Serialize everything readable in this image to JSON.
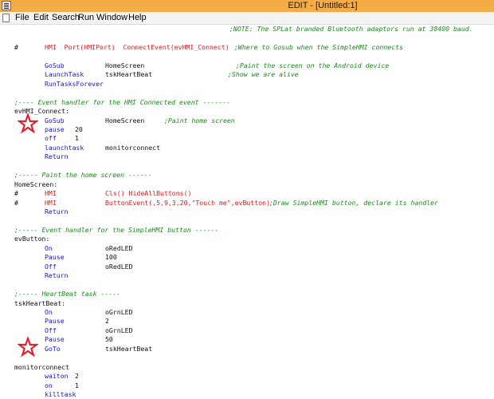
{
  "window": {
    "title": "EDIT - [Untitled:1]"
  },
  "menu": [
    "File",
    "Edit",
    "Search",
    "Run",
    "Window",
    "Help"
  ],
  "code": [
    {
      "t": [
        {
          "c": "cm",
          "s": ";NOTE: The SPLat branded Bluetooth adaptors run at 38400 baud."
        }
      ]
    },
    {
      "t": []
    },
    {
      "t": [
        {
          "c": "txt",
          "s": "#"
        },
        {
          "c": "red",
          "s": "HMI  Port(HMIPort)  ConnectEvent(evHMI_Connect)"
        },
        {
          "c": "cm",
          "s": ";Where to Gosub when the SimpleHMI connects"
        }
      ]
    },
    {
      "t": []
    },
    {
      "t": [
        {
          "c": "kw",
          "s": "GoSub"
        },
        {
          "c": "txt",
          "s": "HomeScreen"
        },
        {
          "c": "cm",
          "s": ";Paint the screen on the Android device"
        }
      ]
    },
    {
      "t": [
        {
          "c": "kw",
          "s": "LaunchTask"
        },
        {
          "c": "txt",
          "s": "tskHeartBeat"
        },
        {
          "c": "cm",
          "s": ";Show we are alive"
        }
      ]
    },
    {
      "t": [
        {
          "c": "kw",
          "s": "RunTasksForever"
        }
      ]
    },
    {
      "t": []
    },
    {
      "t": [
        {
          "c": "cm",
          "s": ";---- Event handler for the HMI Connected event -------"
        }
      ]
    },
    {
      "t": [
        {
          "c": "txt",
          "s": "evHMI_Connect:"
        }
      ]
    },
    {
      "t": [
        {
          "c": "kw",
          "s": "GoSub"
        },
        {
          "c": "txt",
          "s": "HomeScreen"
        },
        {
          "c": "cm",
          "s": ";Paint home screen"
        }
      ]
    },
    {
      "t": [
        {
          "c": "kw",
          "s": "pause"
        },
        {
          "c": "txt",
          "s": "20"
        }
      ]
    },
    {
      "t": [
        {
          "c": "kw",
          "s": "off"
        },
        {
          "c": "txt",
          "s": "1"
        }
      ]
    },
    {
      "t": [
        {
          "c": "kw",
          "s": "launchtask"
        },
        {
          "c": "txt",
          "s": "monitorconnect"
        }
      ]
    },
    {
      "t": [
        {
          "c": "kw",
          "s": "Return"
        }
      ]
    },
    {
      "t": []
    },
    {
      "t": [
        {
          "c": "cm",
          "s": ";----- Paint the home screen ------"
        }
      ]
    },
    {
      "t": [
        {
          "c": "txt",
          "s": "HomeScreen:"
        }
      ]
    },
    {
      "t": [
        {
          "c": "txt",
          "s": "#"
        },
        {
          "c": "red",
          "s": "HMI"
        },
        {
          "c": "red",
          "s": "Cls() HideAllButtons()"
        }
      ]
    },
    {
      "t": [
        {
          "c": "txt",
          "s": "#"
        },
        {
          "c": "red",
          "s": "HMI"
        },
        {
          "c": "red",
          "s": "ButtonEvent(,5,9,3,20,\"Touch me\",evButton)"
        },
        {
          "c": "cm",
          "s": ";Draw SimpleHMI button, declare its handler"
        }
      ]
    },
    {
      "t": [
        {
          "c": "kw",
          "s": "Return"
        }
      ]
    },
    {
      "t": []
    },
    {
      "t": [
        {
          "c": "cm",
          "s": ";----- Event handler for the SimpleHMI button ------"
        }
      ]
    },
    {
      "t": [
        {
          "c": "txt",
          "s": "evButton:"
        }
      ]
    },
    {
      "t": [
        {
          "c": "kw",
          "s": "On"
        },
        {
          "c": "txt",
          "s": "oRedLED"
        }
      ]
    },
    {
      "t": [
        {
          "c": "kw",
          "s": "Pause"
        },
        {
          "c": "txt",
          "s": "100"
        }
      ]
    },
    {
      "t": [
        {
          "c": "kw",
          "s": "Off"
        },
        {
          "c": "txt",
          "s": "oRedLED"
        }
      ]
    },
    {
      "t": [
        {
          "c": "kw",
          "s": "Return"
        }
      ]
    },
    {
      "t": []
    },
    {
      "t": [
        {
          "c": "cm",
          "s": ";----- HeartBeat task -----"
        }
      ]
    },
    {
      "t": [
        {
          "c": "txt",
          "s": "tskHeartBeat:"
        }
      ]
    },
    {
      "t": [
        {
          "c": "kw",
          "s": "On"
        },
        {
          "c": "txt",
          "s": "oGrnLED"
        }
      ]
    },
    {
      "t": [
        {
          "c": "kw",
          "s": "Pause"
        },
        {
          "c": "txt",
          "s": "2"
        }
      ]
    },
    {
      "t": [
        {
          "c": "kw",
          "s": "Off"
        },
        {
          "c": "txt",
          "s": "oGrnLED"
        }
      ]
    },
    {
      "t": [
        {
          "c": "kw",
          "s": "Pause"
        },
        {
          "c": "txt",
          "s": "50"
        }
      ]
    },
    {
      "t": [
        {
          "c": "kw",
          "s": "GoTo"
        },
        {
          "c": "txt",
          "s": "tskHeartBeat"
        }
      ]
    },
    {
      "t": []
    },
    {
      "t": [
        {
          "c": "txt",
          "s": "monitorconnect"
        }
      ]
    },
    {
      "t": [
        {
          "c": "kw",
          "s": "waiton"
        },
        {
          "c": "txt",
          "s": "2"
        }
      ]
    },
    {
      "t": [
        {
          "c": "kw",
          "s": "on"
        },
        {
          "c": "txt",
          "s": "1"
        }
      ]
    },
    {
      "t": [
        {
          "c": "kw",
          "s": "killtask"
        }
      ]
    }
  ],
  "colors": {
    "titlebar": "#f5ab46",
    "keyword": "#1616c8",
    "comment": "#1a8a1a",
    "hmi_red": "#e01818",
    "star": "#e0202a"
  },
  "icons": [
    "app-icon",
    "document-icon",
    "star-annotation-icon"
  ]
}
